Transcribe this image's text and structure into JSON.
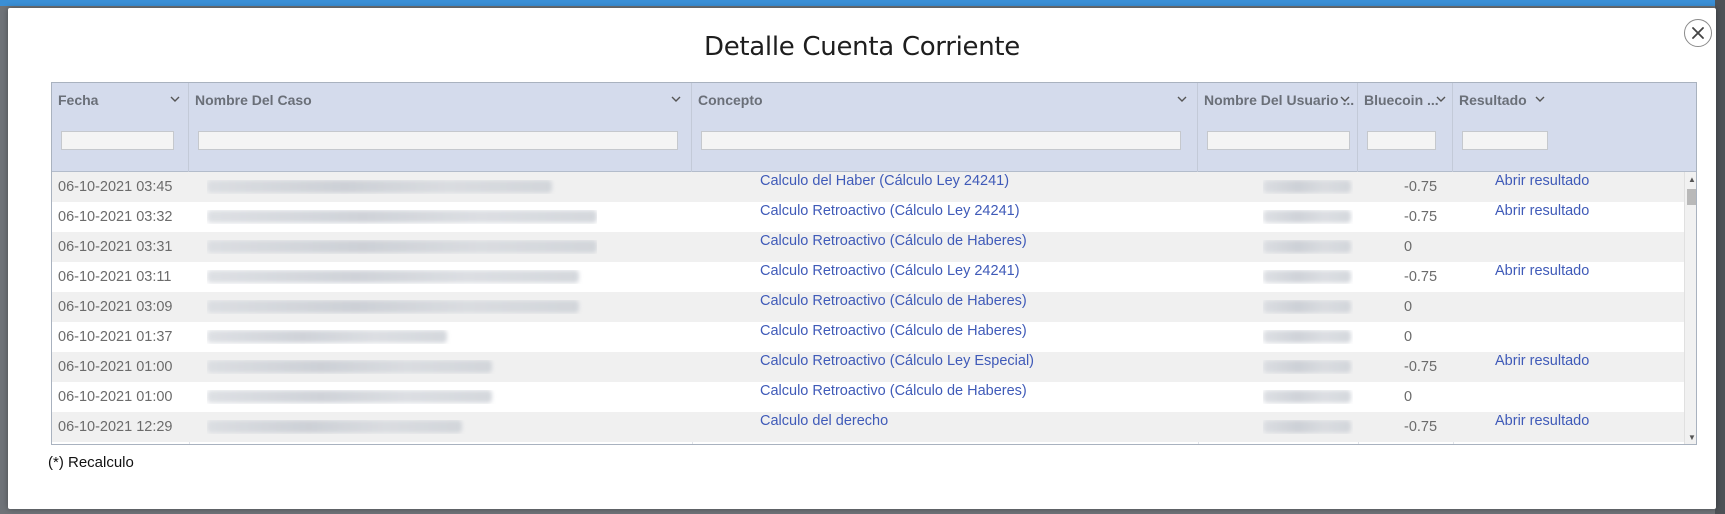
{
  "modal": {
    "title": "Detalle Cuenta Corriente",
    "close_icon": "close-icon",
    "footnote": "(*) Recalculo"
  },
  "colors": {
    "header_bg": "#d4dbec",
    "link": "#3f5ab8",
    "row_alt": "#f0f0f0",
    "top_accent": "#3a8fd6"
  },
  "columns": [
    {
      "label": "Fecha"
    },
    {
      "label": "Nombre Del Caso"
    },
    {
      "label": "Concepto"
    },
    {
      "label": "Nombre Del Usuario ..."
    },
    {
      "label": "Bluecoin ..."
    },
    {
      "label": "Resultado"
    }
  ],
  "rows": [
    {
      "fecha": "06-10-2021 03:45",
      "concepto": "Calculo del Haber (Cálculo Ley 24241)",
      "bluecoin": "-0.75",
      "resultado": "Abrir resultado"
    },
    {
      "fecha": "06-10-2021 03:32",
      "concepto": "Calculo Retroactivo (Cálculo Ley 24241)",
      "bluecoin": "-0.75",
      "resultado": "Abrir resultado"
    },
    {
      "fecha": "06-10-2021 03:31",
      "concepto": "Calculo Retroactivo (Cálculo de Haberes)",
      "bluecoin": "0",
      "resultado": ""
    },
    {
      "fecha": "06-10-2021 03:11",
      "concepto": "Calculo Retroactivo (Cálculo Ley 24241)",
      "bluecoin": "-0.75",
      "resultado": "Abrir resultado"
    },
    {
      "fecha": "06-10-2021 03:09",
      "concepto": "Calculo Retroactivo (Cálculo de Haberes)",
      "bluecoin": "0",
      "resultado": ""
    },
    {
      "fecha": "06-10-2021 01:37",
      "concepto": "Calculo Retroactivo (Cálculo de Haberes)",
      "bluecoin": "0",
      "resultado": ""
    },
    {
      "fecha": "06-10-2021 01:00",
      "concepto": "Calculo Retroactivo (Cálculo Ley Especial)",
      "bluecoin": "-0.75",
      "resultado": "Abrir resultado"
    },
    {
      "fecha": "06-10-2021 01:00",
      "concepto": "Calculo Retroactivo (Cálculo de Haberes)",
      "bluecoin": "0",
      "resultado": ""
    },
    {
      "fecha": "06-10-2021 12:29",
      "concepto": "Calculo del derecho",
      "bluecoin": "-0.75",
      "resultado": "Abrir resultado"
    }
  ]
}
